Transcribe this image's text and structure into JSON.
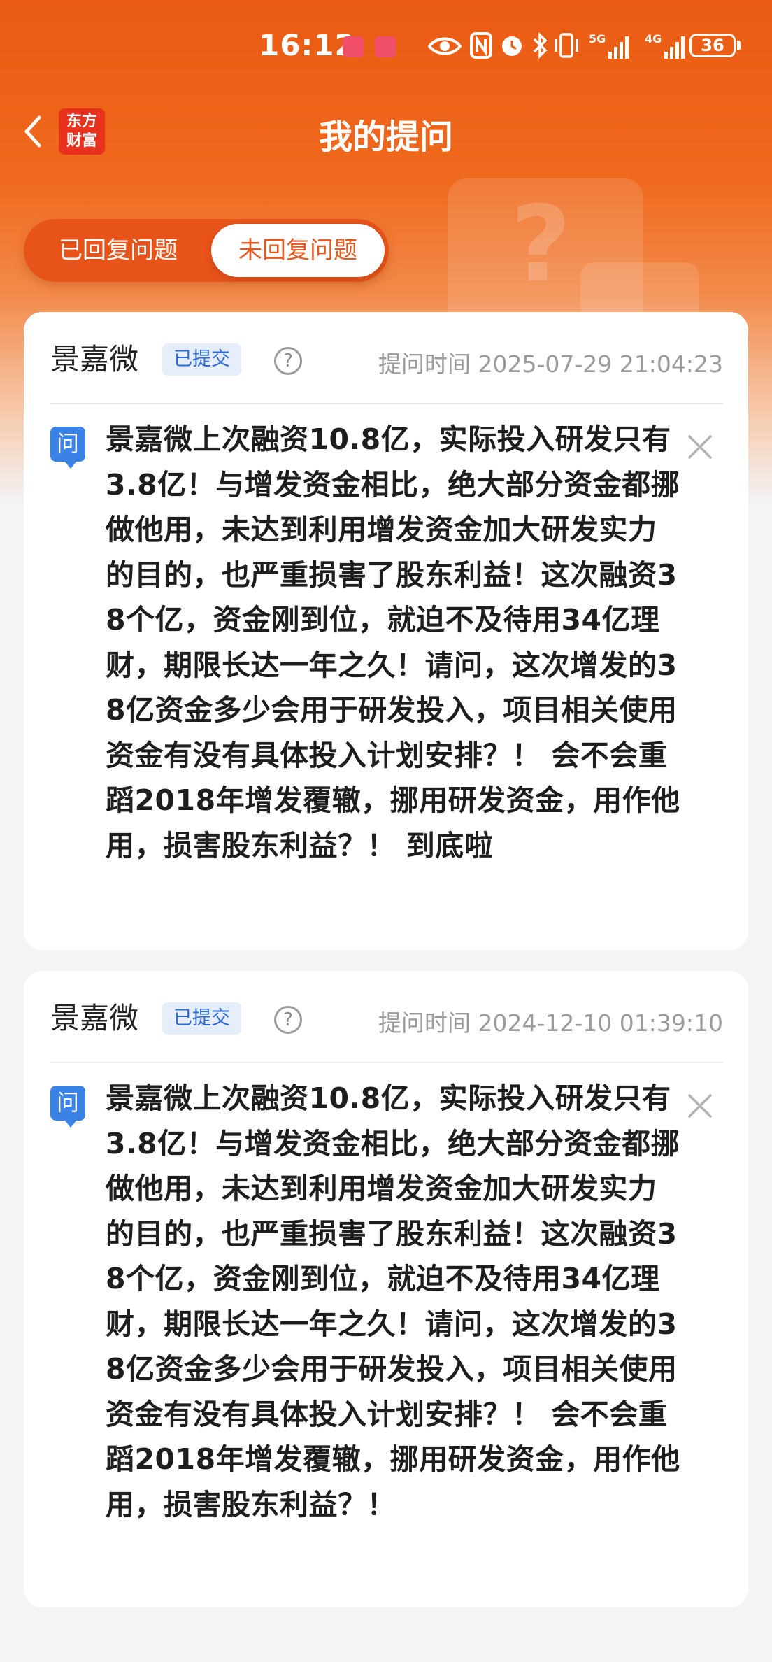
{
  "status_bar": {
    "time": "16:12",
    "network_1": "5G",
    "network_2": "4G",
    "battery": "36",
    "icons": [
      "eye-icon",
      "nfc-icon",
      "alarm-icon",
      "bluetooth-icon",
      "vibrate-icon"
    ]
  },
  "nav": {
    "title": "我的提问",
    "logo_line1": "东方",
    "logo_line2": "财富"
  },
  "tabs": [
    {
      "label": "已回复问题",
      "active": false
    },
    {
      "label": "未回复问题",
      "active": true
    }
  ],
  "colors": {
    "brand": "#ea5a12",
    "badge_text": "#2c6bd9",
    "question_icon": "#3b82e6"
  },
  "questions": [
    {
      "company": "景嘉微",
      "status": "已提交",
      "help": "?",
      "time": "提问时间 2025-07-29 21:04:23",
      "icon_label": "问",
      "text": "景嘉微上次融资10.8亿，实际投入研发只有3.8亿！与增发资金相比，绝大部分资金都挪做他用，未达到利用增发资金加大研发实力的目的，也严重损害了股东利益！这次融资38个亿，资金刚到位，就迫不及待用34亿理财，期限长达一年之久！请问，这次增发的38亿资金多少会用于研发投入，项目相关使用资金有没有具体投入计划安排？！ 会不会重蹈2018年增发覆辙，挪用研发资金，用作他用，损害股东利益？！ 到底啦"
    },
    {
      "company": "景嘉微",
      "status": "已提交",
      "help": "?",
      "time": "提问时间 2024-12-10 01:39:10",
      "icon_label": "问",
      "text": "景嘉微上次融资10.8亿，实际投入研发只有3.8亿！与增发资金相比，绝大部分资金都挪做他用，未达到利用增发资金加大研发实力的目的，也严重损害了股东利益！这次融资38个亿，资金刚到位，就迫不及待用34亿理财，期限长达一年之久！请问，这次增发的38亿资金多少会用于研发投入，项目相关使用资金有没有具体投入计划安排？！ 会不会重蹈2018年增发覆辙，挪用研发资金，用作他用，损害股东利益？！"
    }
  ]
}
